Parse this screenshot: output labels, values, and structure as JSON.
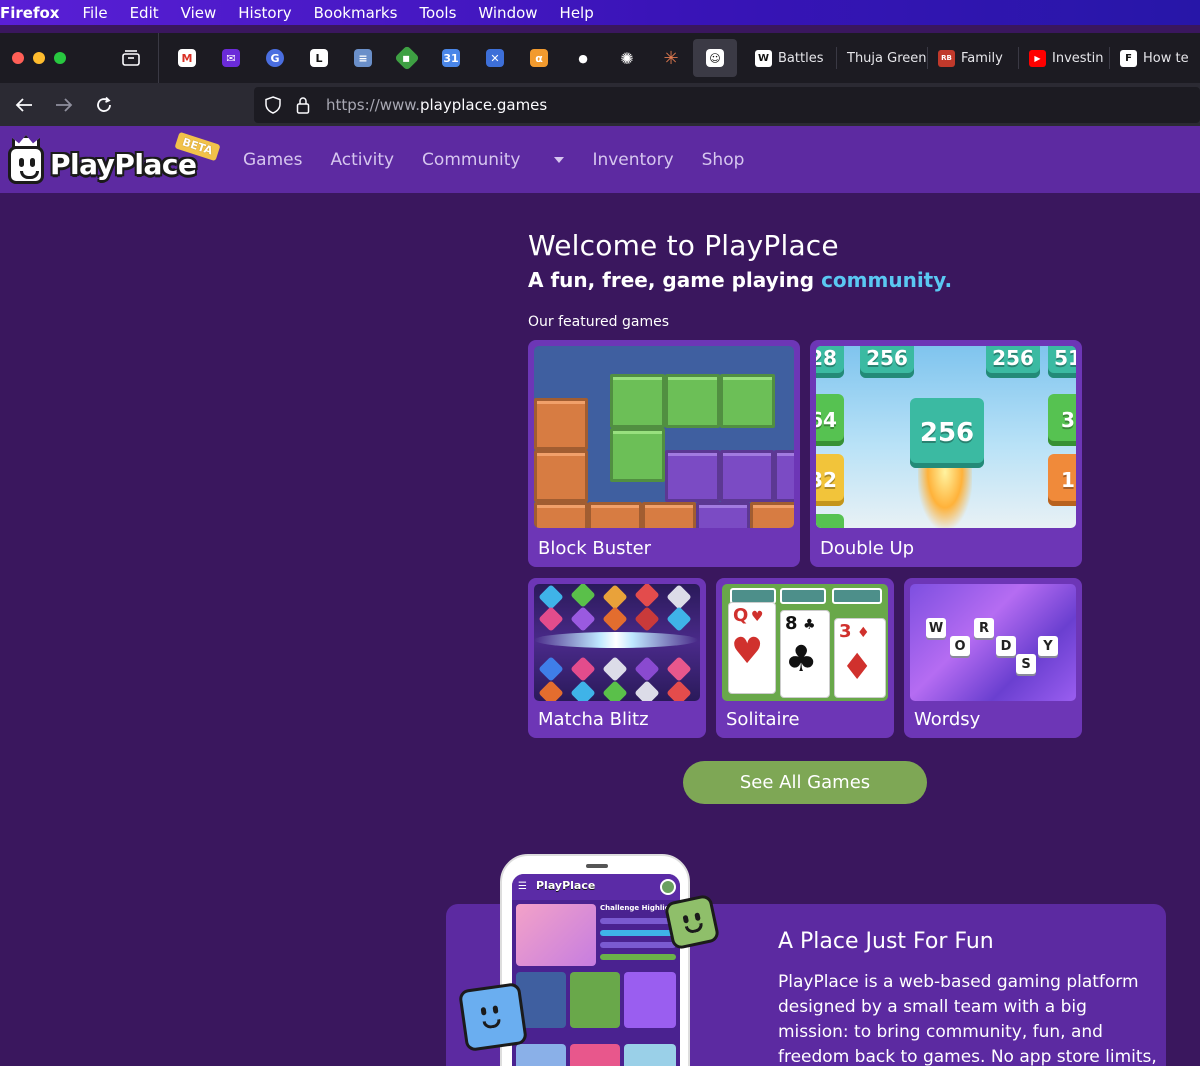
{
  "menubar": {
    "app": "Firefox",
    "items": [
      "File",
      "Edit",
      "View",
      "History",
      "Bookmarks",
      "Tools",
      "Window",
      "Help"
    ]
  },
  "tabs": {
    "text_tabs": [
      {
        "label": "Battles",
        "favicon": "W",
        "color": "#ffffff"
      },
      {
        "label": "Thuja Green",
        "favicon": "",
        "color": "#6fae4a"
      },
      {
        "label": "Family",
        "favicon": "RB",
        "color": "#c0392b"
      },
      {
        "label": "Investin",
        "favicon": "▶",
        "color": "#ff0000"
      },
      {
        "label": "How te",
        "favicon": "F",
        "color": "#ffffff"
      }
    ]
  },
  "navbar": {
    "url_prefix": "https://www.",
    "url_domain": "playplace.games"
  },
  "site": {
    "logo_text": "PlayPlace",
    "beta_badge": "BETA",
    "nav": [
      "Games",
      "Activity",
      "Community",
      "Inventory",
      "Shop"
    ]
  },
  "hero": {
    "title": "Welcome to PlayPlace",
    "subtitle_lead": "A fun, free, game playing ",
    "subtitle_accent": "community.",
    "featured_label": "Our featured games"
  },
  "games": [
    {
      "name": "Block Buster"
    },
    {
      "name": "Double Up"
    },
    {
      "name": "Matcha Blitz"
    },
    {
      "name": "Solitaire"
    },
    {
      "name": "Wordsy"
    }
  ],
  "double_up_tiles": [
    "28",
    "256",
    "256",
    "51",
    "64",
    "256",
    "3",
    "32",
    "1"
  ],
  "solitaire_cards": [
    {
      "rank": "Q",
      "suit": "♥",
      "color": "#d0312d"
    },
    {
      "rank": "8",
      "suit": "♣",
      "color": "#111111"
    },
    {
      "rank": "3",
      "suit": "♦",
      "color": "#d0312d"
    }
  ],
  "wordsy_letters": [
    "W",
    "O",
    "R",
    "D",
    "S",
    "Y"
  ],
  "see_all_label": "See All Games",
  "about": {
    "title": "A Place Just For Fun",
    "body": "PlayPlace is a web-based gaming platform designed by a small team with a big mission: to bring community, fun, and freedom back to games. No app store limits, no constant"
  },
  "phone": {
    "logo": "PlayPlace",
    "challenge": "Challenge Highlight"
  },
  "colors": {
    "page_bg": "#3a175e",
    "header_bg": "#5d2aa1",
    "card_bg": "#6d36b6",
    "accent": "#5ac8f2",
    "cta": "#7ea755"
  }
}
